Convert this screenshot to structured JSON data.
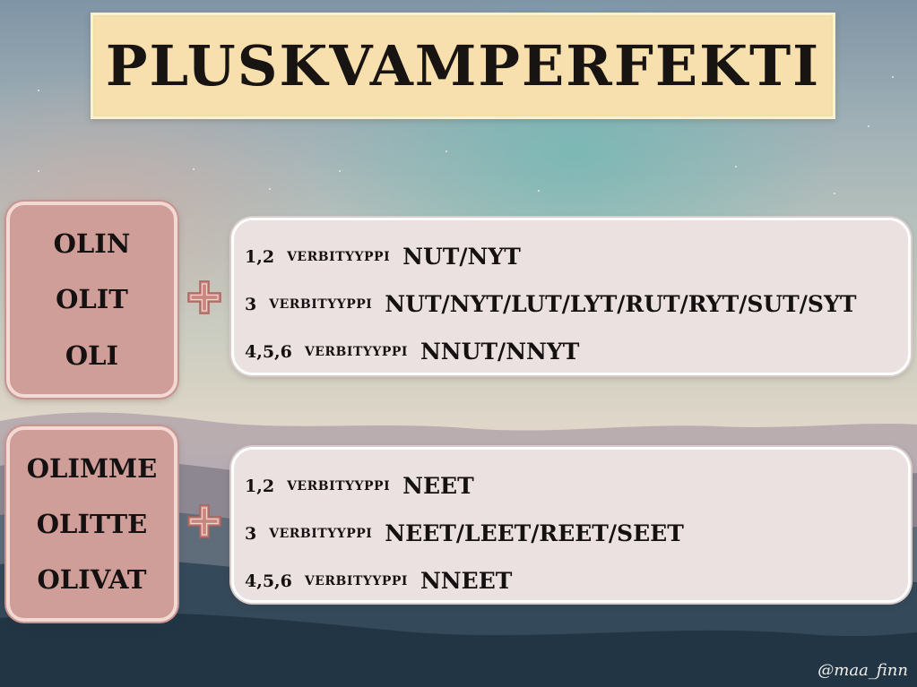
{
  "title": "PLUSKVAMPERFEKTI",
  "singular": {
    "pronouns": [
      "OLIN",
      "OLIT",
      "OLI"
    ],
    "rules": [
      {
        "types": "1,2",
        "label": "VERBITYYPPI",
        "ending": "NUT/NYT"
      },
      {
        "types": "3",
        "label": "VERBITYYPPI",
        "ending": "NUT/NYT/LUT/LYT/RUT/RYT/SUT/SYT"
      },
      {
        "types": "4,5,6",
        "label": "VERBITYYPPI",
        "ending": "NNUT/NNYT"
      }
    ]
  },
  "plural": {
    "pronouns": [
      "OLIMME",
      "OLITTE",
      "OLIVAT"
    ],
    "rules": [
      {
        "types": "1,2",
        "label": "VERBITYYPPI",
        "ending": "NEET"
      },
      {
        "types": "3",
        "label": "VERBITYYPPI",
        "ending": "NEET/LEET/REET/SEET"
      },
      {
        "types": "4,5,6",
        "label": "VERBITYYPPI",
        "ending": "NNEET"
      }
    ]
  },
  "plus_icon": "plus-icon",
  "credit": "@maa_finn",
  "colors": {
    "title_bg": "#f8dfae",
    "pronoun_box": "#d09e98",
    "rule_box": "#ebe1e0",
    "plus": "#c8877f",
    "text": "#151111"
  }
}
